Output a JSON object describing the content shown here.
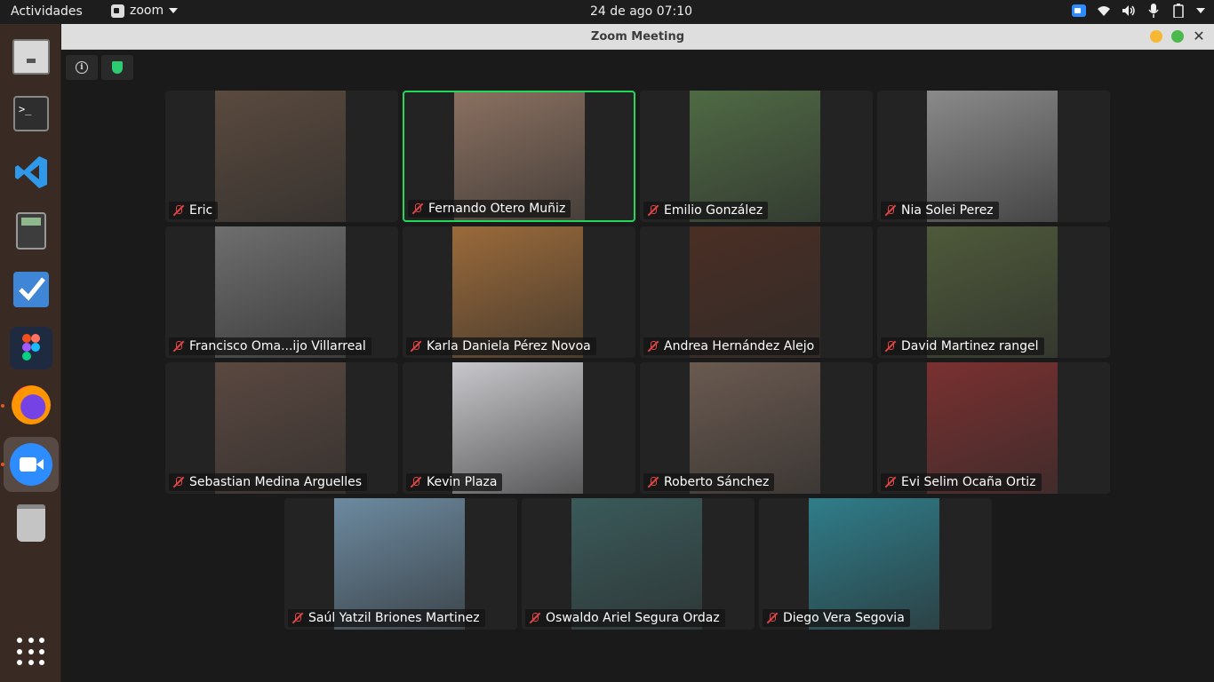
{
  "topbar": {
    "activities": "Actividades",
    "app_name": "zoom",
    "clock": "24 de ago  07:10"
  },
  "window": {
    "title": "Zoom Meeting"
  },
  "participants": [
    {
      "name": "Eric",
      "muted": true,
      "speaking": false,
      "bg": "#5a4a3e"
    },
    {
      "name": "Fernando Otero Muñiz",
      "muted": true,
      "speaking": true,
      "bg": "#8a7060"
    },
    {
      "name": "Emilio González",
      "muted": true,
      "speaking": false,
      "bg": "#4f6a44"
    },
    {
      "name": "Nia Solei Perez",
      "muted": true,
      "speaking": false,
      "bg": "#8a8a8a"
    },
    {
      "name": "Francisco Oma...ijo Villarreal",
      "muted": true,
      "speaking": false,
      "bg": "#6e6e6e"
    },
    {
      "name": "Karla Daniela Pérez Novoa",
      "muted": true,
      "speaking": false,
      "bg": "#9a6a3a"
    },
    {
      "name": "Andrea Hernández Alejo",
      "muted": true,
      "speaking": false,
      "bg": "#4a2e24"
    },
    {
      "name": "David Martinez rangel",
      "muted": true,
      "speaking": false,
      "bg": "#4e5a3a"
    },
    {
      "name": "Sebastian Medina Arguelles",
      "muted": true,
      "speaking": false,
      "bg": "#5a4840"
    },
    {
      "name": "Kevin Plaza",
      "muted": true,
      "speaking": false,
      "bg": "#c8c8cc"
    },
    {
      "name": "Roberto Sánchez",
      "muted": true,
      "speaking": false,
      "bg": "#6a5a50"
    },
    {
      "name": "Evi Selim Ocaña Ortiz",
      "muted": true,
      "speaking": false,
      "bg": "#7a3030"
    },
    {
      "name": "Saúl Yatzil Briones Martinez",
      "muted": true,
      "speaking": false,
      "bg": "#6c8aa0"
    },
    {
      "name": "Oswaldo Ariel Segura Ordaz",
      "muted": true,
      "speaking": false,
      "bg": "#3a5a5a"
    },
    {
      "name": "Diego Vera Segovia",
      "muted": true,
      "speaking": false,
      "bg": "#2f7d8a"
    }
  ],
  "dock": [
    {
      "name": "files-icon"
    },
    {
      "name": "terminal-icon"
    },
    {
      "name": "vscode-icon"
    },
    {
      "name": "calculator-icon"
    },
    {
      "name": "todo-icon"
    },
    {
      "name": "figma-icon"
    },
    {
      "name": "firefox-icon"
    },
    {
      "name": "zoom-icon"
    },
    {
      "name": "trash-icon"
    },
    {
      "name": "show-apps-icon"
    }
  ]
}
